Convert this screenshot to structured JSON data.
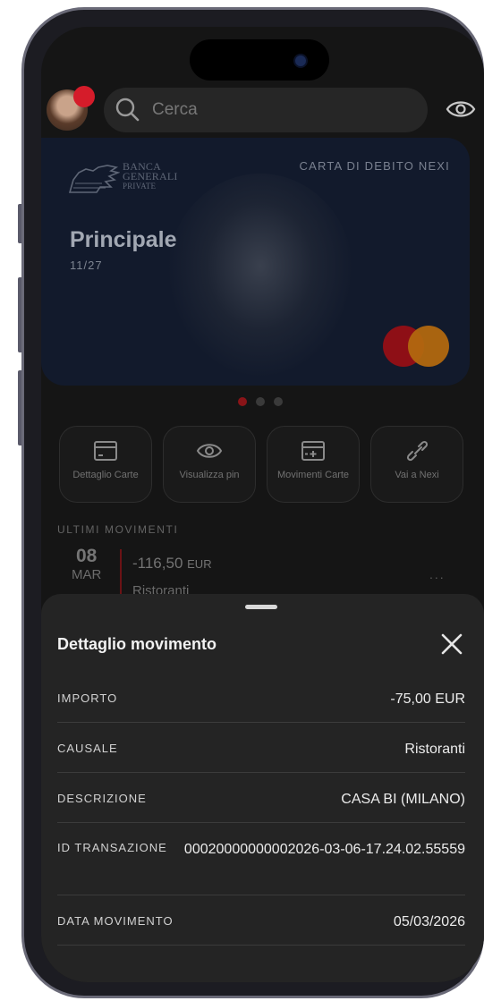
{
  "header": {
    "search_placeholder": "Cerca"
  },
  "card": {
    "bank_line1": "BANCA",
    "bank_line2": "GENERALI",
    "bank_line3": "PRIVATE",
    "type": "CARTA DI DEBITO NEXI",
    "name": "Principale",
    "expiry": "11/27",
    "pager_total": 3,
    "pager_active": 1
  },
  "actions": [
    {
      "label": "Dettaglio Carte",
      "icon": "card-icon"
    },
    {
      "label": "Visualizza pin",
      "icon": "eye-icon"
    },
    {
      "label": "Movimenti Carte",
      "icon": "card-plus-icon"
    },
    {
      "label": "Vai a Nexi",
      "icon": "link-icon"
    }
  ],
  "movements": {
    "section_title": "ULTIMI MOVIMENTI",
    "items": [
      {
        "day": "08",
        "month": "MAR",
        "amount": "-116,50",
        "currency": "EUR",
        "category": "Ristoranti",
        "more": "..."
      }
    ]
  },
  "sheet": {
    "title": "Dettaglio movimento",
    "rows": [
      {
        "key": "IMPORTO",
        "value": "-75,00 EUR"
      },
      {
        "key": "CAUSALE",
        "value": "Ristoranti"
      },
      {
        "key": "DESCRIZIONE",
        "value": "CASA BI (MILANO)"
      },
      {
        "key": "ID TRANSAZIONE",
        "value": "00020000000002026-03-06-17.24.02.55559"
      },
      {
        "key": "DATA MOVIMENTO",
        "value": "05/03/2026"
      }
    ]
  },
  "colors": {
    "accent_red": "#d51c2a",
    "card_bg": "#121a2c",
    "sheet_bg": "#242424"
  }
}
